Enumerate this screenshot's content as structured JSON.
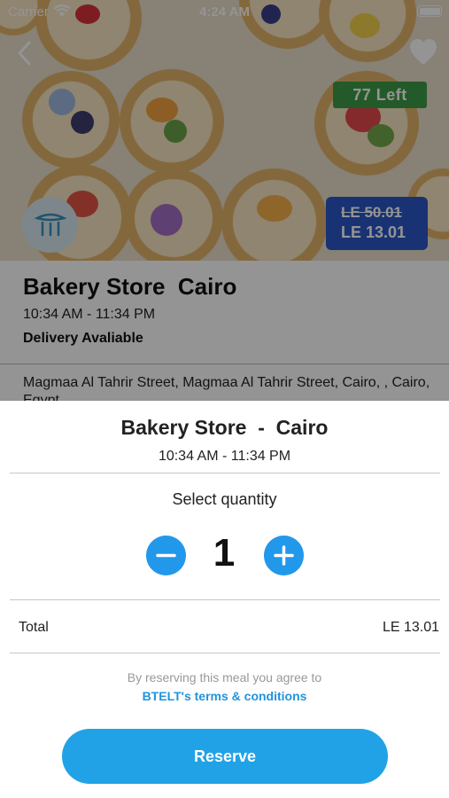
{
  "status_bar": {
    "carrier": "Carrier",
    "time": "4:24 AM"
  },
  "listing": {
    "left_badge": "77  Left",
    "price_original": "LE 50.01",
    "price_current": "LE 13.01",
    "store_title": "Bakery Store  Cairo",
    "hours": "10:34 AM - 11:34 PM",
    "delivery": "Delivery Avaliable",
    "address": "Magmaa Al Tahrir Street, Magmaa Al Tahrir Street, Cairo, , Cairo, Egypt"
  },
  "sheet": {
    "title": "Bakery Store  -  Cairo",
    "hours": "10:34 AM - 11:34 PM",
    "quantity_label": "Select quantity",
    "quantity": "1",
    "total_label": "Total",
    "total_value": "LE 13.01",
    "agree_text": "By reserving this meal you agree to",
    "terms_link": "BTELT's terms & conditions",
    "reserve_label": "Reserve"
  },
  "colors": {
    "accent": "#22a2e6",
    "badge_green": "#3f9b47",
    "badge_blue": "#2a56c6"
  },
  "icons": [
    "wifi-icon",
    "battery-icon",
    "back-icon",
    "heart-icon",
    "store-logo-icon",
    "minus-icon",
    "plus-icon"
  ]
}
